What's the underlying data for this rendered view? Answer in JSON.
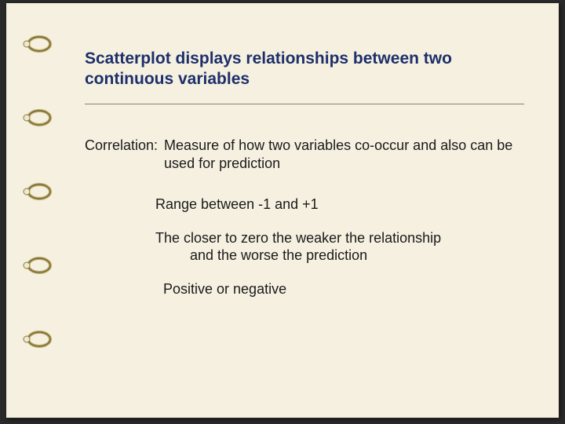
{
  "title": "Scatterplot displays relationships between two continuous variables",
  "definition": {
    "label": "Correlation:",
    "text": "Measure of how two variables co-occur and also can be used for prediction"
  },
  "points": {
    "range": "Range between -1 and +1",
    "closer_line1": "The closer to zero the weaker the relationship",
    "closer_line2": "and the worse the prediction",
    "sign": "Positive or negative"
  }
}
